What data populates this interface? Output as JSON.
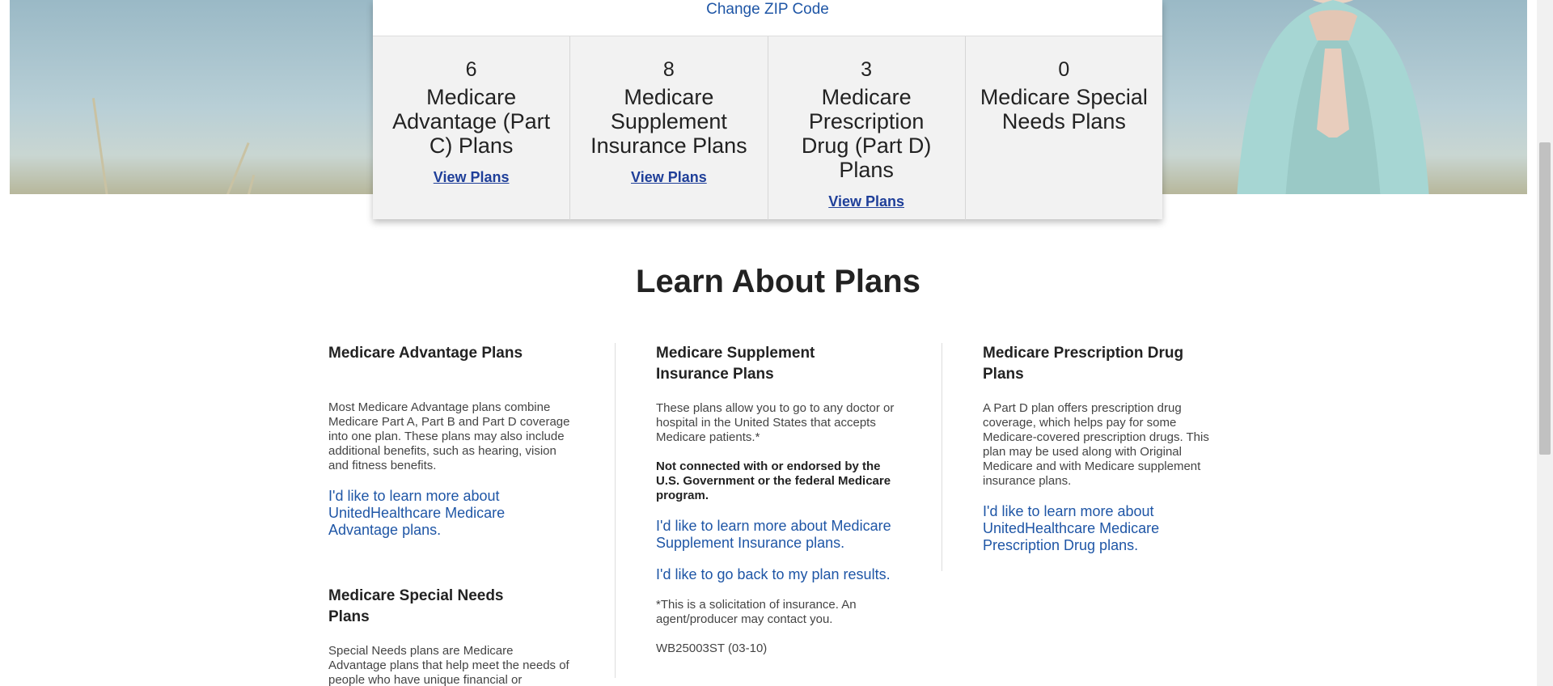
{
  "hero": {
    "zip_link": "Change ZIP Code"
  },
  "plans": [
    {
      "count": "6",
      "name": "Medicare Advantage (Part C) Plans",
      "link": "View Plans"
    },
    {
      "count": "8",
      "name": "Medicare Supplement Insurance Plans",
      "link": "View Plans"
    },
    {
      "count": "3",
      "name": "Medicare Prescription Drug (Part D) Plans",
      "link": "View Plans"
    },
    {
      "count": "0",
      "name": "Medicare Special Needs Plans",
      "link": ""
    }
  ],
  "learn": {
    "title": "Learn About Plans",
    "col1": {
      "heading": "Medicare Advantage Plans",
      "body": "Most Medicare Advantage plans combine Medicare Part A, Part B and Part D coverage into one plan. These plans may also include additional benefits, such as hearing, vision and fitness benefits.",
      "link": "I'd like to learn more about UnitedHealthcare Medicare Advantage plans.",
      "heading2": "Medicare Special Needs Plans",
      "body2": "Special Needs plans are Medicare Advantage plans that help meet the needs of people who have unique financial or"
    },
    "col2": {
      "heading": "Medicare Supplement Insurance Plans",
      "body": "These plans allow you to go to any doctor or hospital in the United States that accepts Medicare patients.*",
      "bold_notice": "Not connected with or endorsed by the U.S. Government or the federal Medicare program.",
      "link1": "I'd like to learn more about Medicare Supplement Insurance plans.",
      "link2": "I'd like to go back to my plan results.",
      "footnote": "*This is a solicitation of insurance. An agent/producer may contact you.",
      "code": "WB25003ST (03-10)"
    },
    "col3": {
      "heading": "Medicare Prescription Drug Plans",
      "body": "A Part D plan offers prescription drug coverage, which helps pay for some Medicare-covered prescription drugs. This plan may be used along with Original Medicare and with Medicare supplement insurance plans.",
      "link": "I'd like to learn more about UnitedHealthcare Medicare Prescription Drug plans."
    }
  },
  "icons": {
    "hero_image": "woman-meditating-image"
  }
}
